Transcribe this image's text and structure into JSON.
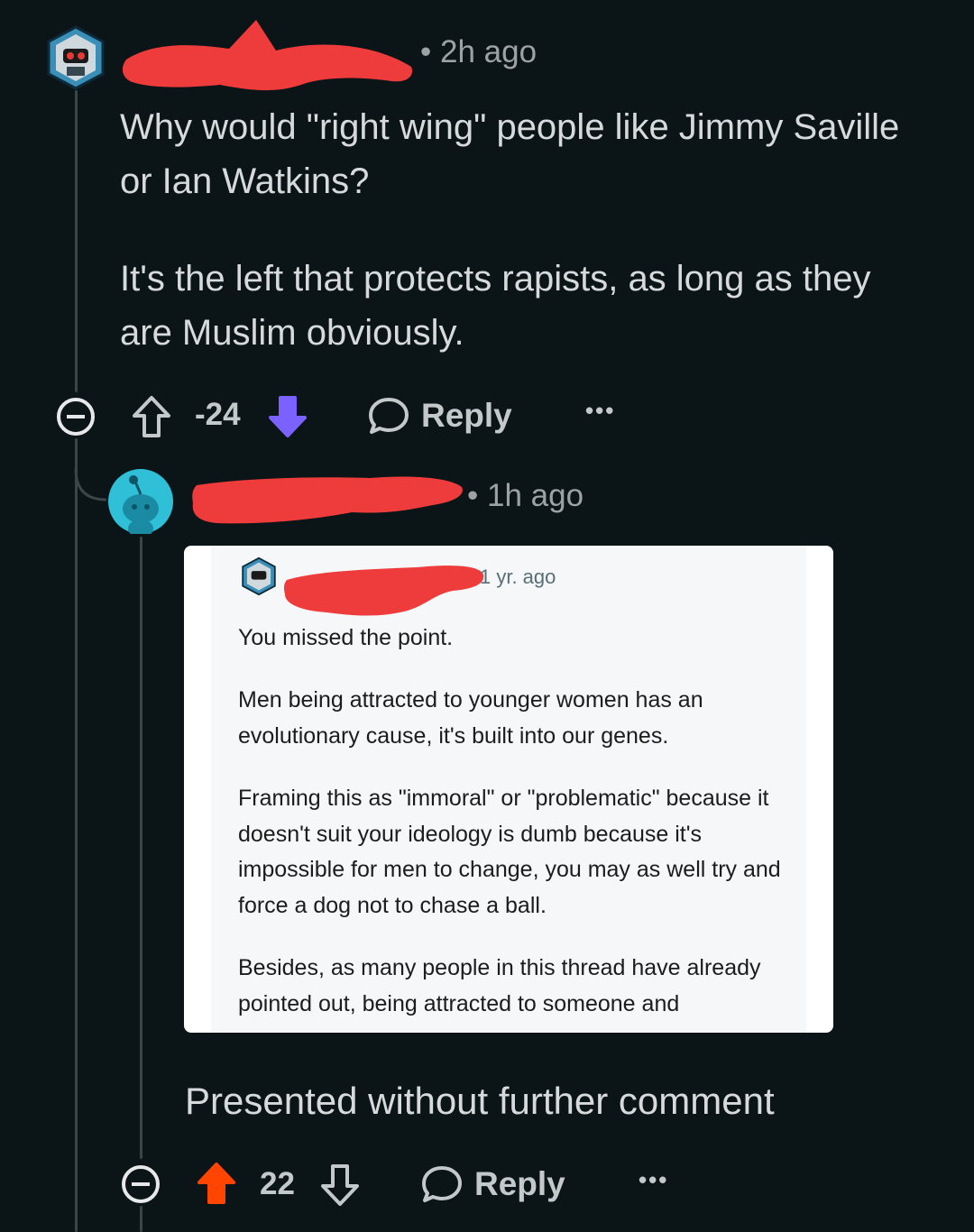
{
  "comment1": {
    "time": "2h ago",
    "paragraphs": [
      "Why would \"right wing\" people like Jimmy Saville or Ian Watkins?",
      "It's the left that protects rapists, as long as they are Muslim obviously."
    ],
    "score": "-24",
    "reply_label": "Reply",
    "more_label": "•••",
    "vote_state": "downvoted",
    "vote_color": "#7b61ff"
  },
  "comment2": {
    "time": "1h ago",
    "embedded": {
      "time": "1 yr. ago",
      "paragraphs": [
        "You missed the point.",
        "Men being attracted to younger women has an evolutionary cause, it's built into our genes.",
        "Framing this as \"immoral\" or \"problematic\" because it doesn't suit your ideology is dumb because it's impossible for men to change, you may as well try and force a dog not to chase a ball.",
        "Besides, as many people in this thread have already pointed out, being attracted to someone and"
      ]
    },
    "text": "Presented without further comment",
    "score": "22",
    "reply_label": "Reply",
    "more_label": "•••",
    "vote_state": "upvoted",
    "vote_color": "#ff4500"
  },
  "icons": [
    "collapse-icon",
    "upvote-icon",
    "downvote-icon",
    "reply-icon",
    "more-icon"
  ]
}
